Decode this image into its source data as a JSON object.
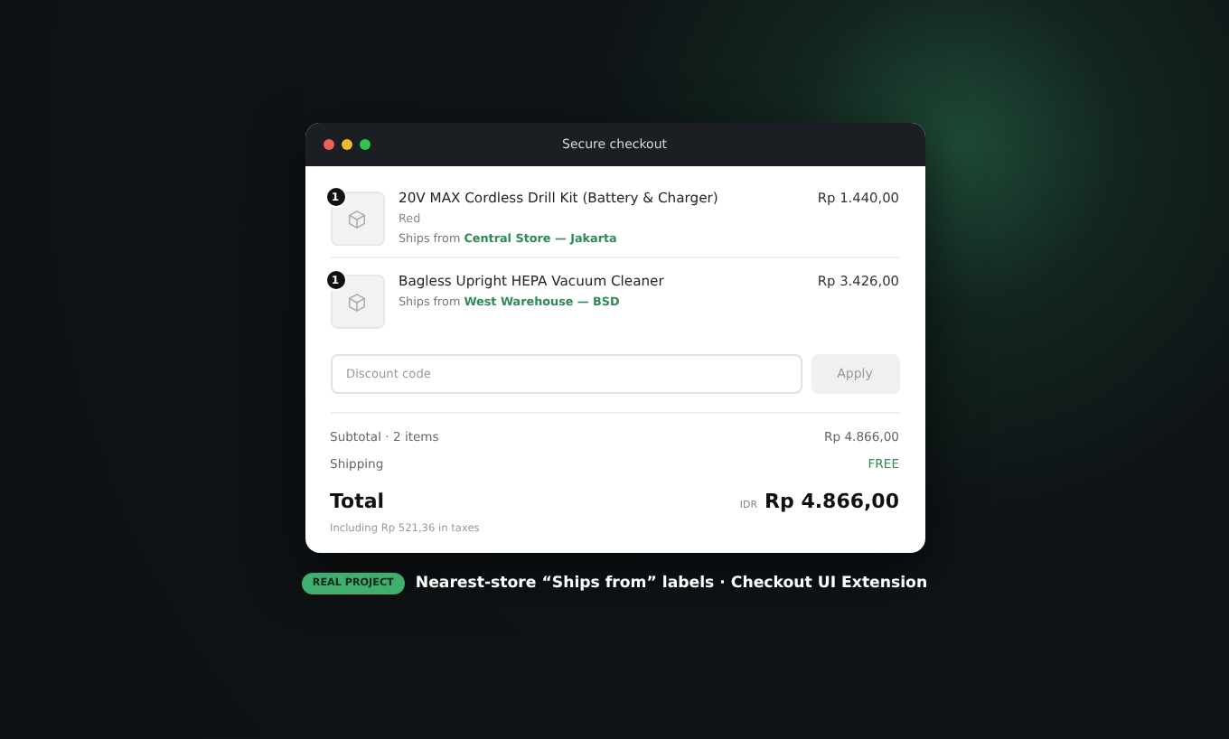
{
  "window": {
    "title": "Secure checkout"
  },
  "items": [
    {
      "quantity": "1",
      "name": "20V MAX Cordless Drill Kit (Battery & Charger)",
      "variant": "Red",
      "ships_prefix": "Ships from",
      "ships_from": "Central Store — Jakarta",
      "price": "Rp 1.440,00"
    },
    {
      "quantity": "1",
      "name": "Bagless Upright HEPA Vacuum Cleaner",
      "ships_prefix": "Ships from",
      "ships_from": "West Warehouse — BSD",
      "price": "Rp 3.426,00"
    }
  ],
  "discount": {
    "placeholder": "Discount code",
    "button": "Apply",
    "disabled": true
  },
  "summary": [
    {
      "label": "Subtotal · 2 items",
      "value": "Rp 4.866,00",
      "kind": "plain"
    },
    {
      "label": "Shipping",
      "value": "FREE",
      "kind": "free"
    }
  ],
  "total": {
    "label": "Total",
    "currency": "IDR",
    "value": "Rp 4.866,00",
    "taxes": "Including Rp 521,36 in taxes"
  },
  "caption": {
    "badge": "REAL PROJECT",
    "text": "Nearest-store “Ships from” labels · Checkout UI Extension"
  }
}
